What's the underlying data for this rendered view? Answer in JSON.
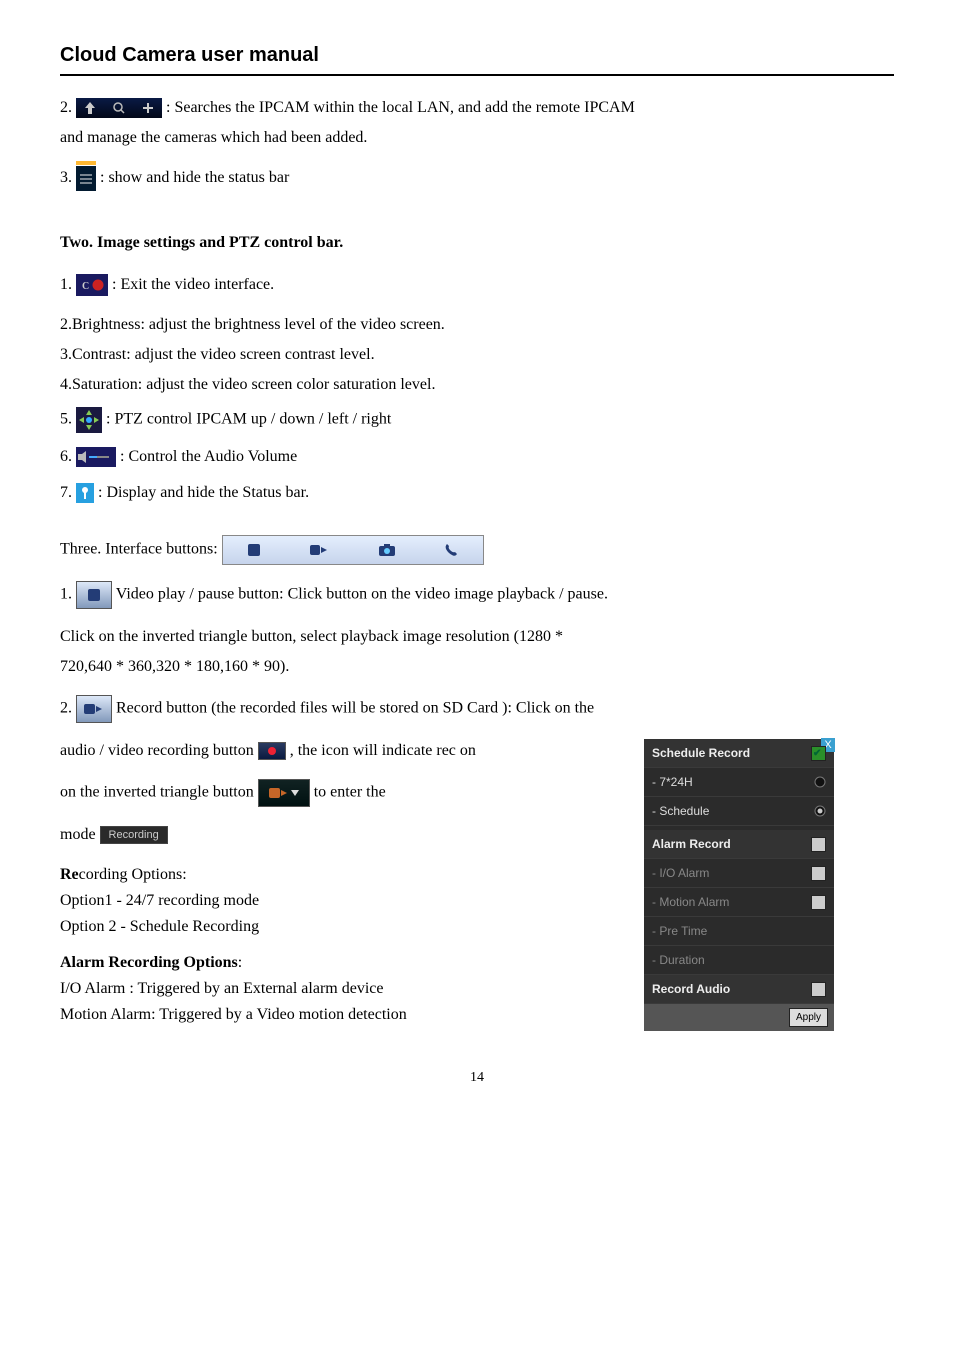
{
  "title": "Cloud Camera user manual",
  "top": {
    "item2": ": Searches the IPCAM within the local LAN, and add the remote IPCAM",
    "item2_line2": "and manage the cameras which had been added.",
    "item3": ": show and hide the status bar"
  },
  "two": {
    "heading": "Two. Image settings and PTZ control bar.",
    "i1": ": Exit the video interface.",
    "i2": "2.Brightness: adjust the brightness level of the video screen.",
    "i3": "3.Contrast: adjust the video screen contrast level.",
    "i4": "4.Saturation: adjust the video screen color saturation level.",
    "i5": ": PTZ control IPCAM up / down / left / right",
    "i6": ": Control the Audio Volume",
    "i7": " : Display and hide the Status bar."
  },
  "three": {
    "heading": "Three. Interface buttons:",
    "i1": " Video play / pause button: Click button on the video image playback / pause.",
    "p2a": "Click on the inverted triangle button, select playback image resolution (1280 *",
    "p2b": "720,640 * 360,320 * 180,160 * 90).",
    "i2": "Record button (the recorded files will be  stored on SD Card ): Click on the",
    "audio_a": "audio / video recording button ",
    "audio_b": " , the icon will indicate rec on",
    "inv_a": "on the inverted triangle button ",
    "inv_b": " to enter the",
    "mode": "mode ",
    "mode_btn": "Recording",
    "rec_opt_hdr_bold": "Re",
    "rec_opt_hdr_rest": "cording Options:",
    "opt1": "Option1 - 24/7 recording mode",
    "opt2": "Option 2 - Schedule Recording",
    "alarm_hdr": "Alarm Recording Options",
    "alarm_colon": ":",
    "io": "I/O Alarm : Triggered by an External alarm device",
    "motion": "Motion Alarm: Triggered by a Video motion detection"
  },
  "panel": {
    "schedule_record": "Schedule Record",
    "r724": "- 7*24H",
    "sched": "- Schedule",
    "alarm_record": "Alarm Record",
    "io": "- I/O Alarm",
    "motion": "- Motion Alarm",
    "pre": "- Pre Time",
    "dur": "- Duration",
    "rec_audio": "Record Audio",
    "apply": "Apply"
  },
  "page": "14"
}
